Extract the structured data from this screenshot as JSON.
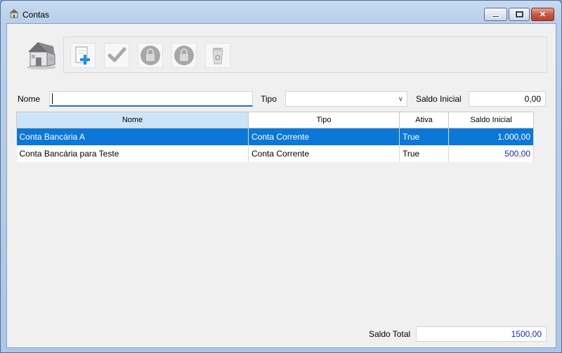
{
  "window": {
    "title": "Contas"
  },
  "toolbar": {
    "buttons": [
      "new-icon",
      "check-icon",
      "lock-icon",
      "lock-icon",
      "trash-icon"
    ]
  },
  "form": {
    "nome_label": "Nome",
    "nome_value": "",
    "tipo_label": "Tipo",
    "tipo_value": "",
    "saldo_label": "Saldo Inicial",
    "saldo_value": "0,00"
  },
  "table": {
    "columns": [
      "Nome",
      "Tipo",
      "Ativa",
      "Saldo Inicial"
    ],
    "rows": [
      {
        "nome": "Conta Bancária A",
        "tipo": "Conta Corrente",
        "ativa": "True",
        "saldo": "1.000,00",
        "selected": true
      },
      {
        "nome": "Conta Bancária para Teste",
        "tipo": "Conta Corrente",
        "ativa": "True",
        "saldo": "500,00",
        "selected": false
      }
    ]
  },
  "footer": {
    "total_label": "Saldo Total",
    "total_value": "1500,00"
  },
  "colors": {
    "selection": "#0b78d7",
    "header_selected": "#cce4f7",
    "number_blue": "#1b25c4"
  }
}
